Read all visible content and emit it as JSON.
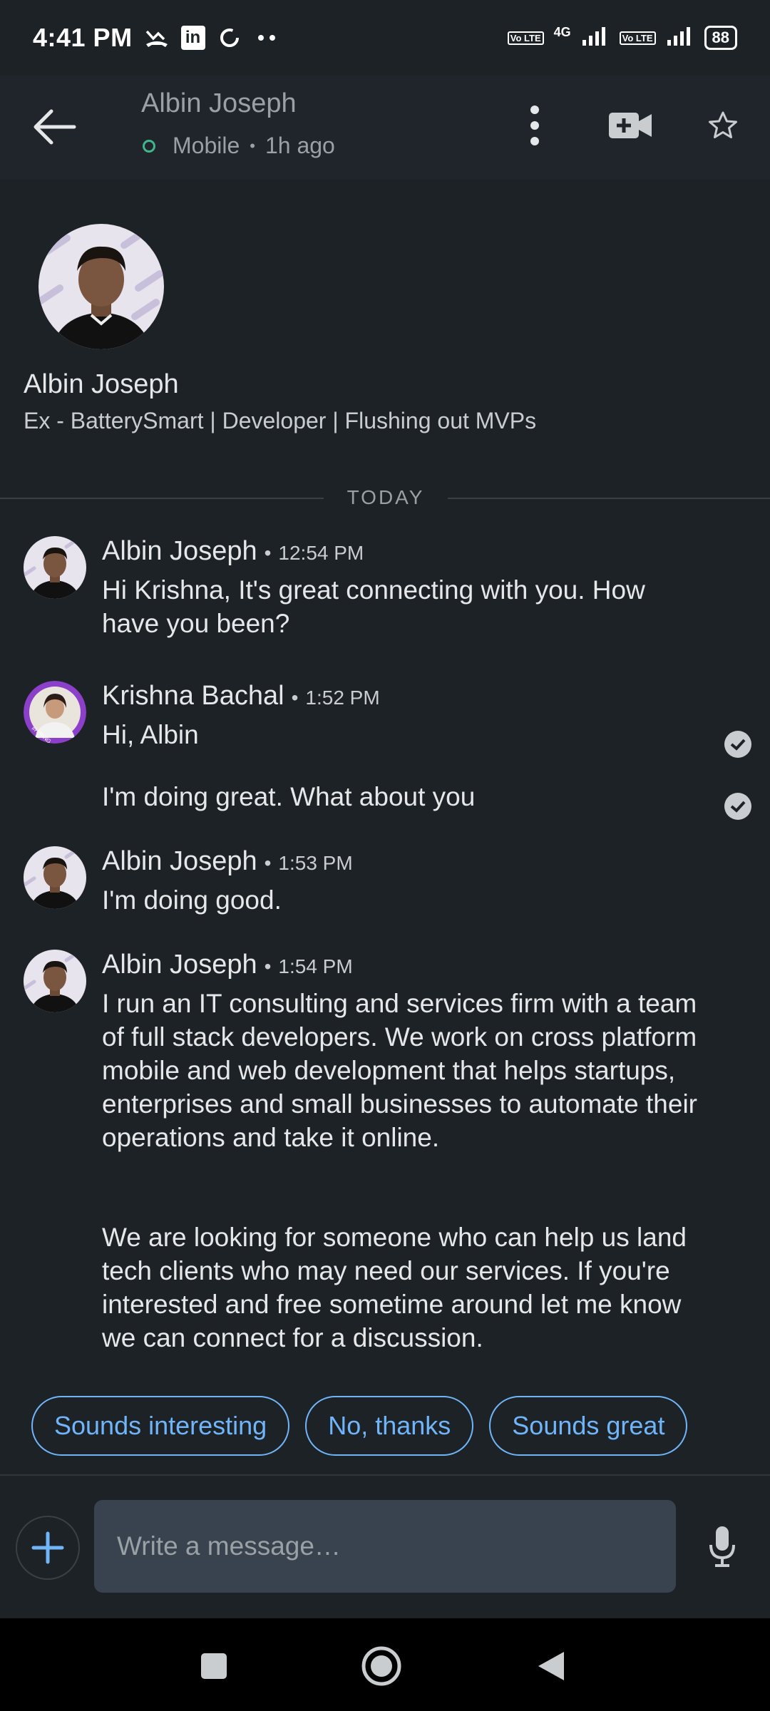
{
  "status_bar": {
    "time": "4:41 PM",
    "network_label": "4G",
    "volte_label": "Vo LTE",
    "battery": "88"
  },
  "header": {
    "name": "Albin Joseph",
    "device": "Mobile",
    "last_seen": "1h ago"
  },
  "profile": {
    "name": "Albin Joseph",
    "headline": "Ex - BatterySmart | Developer | Flushing out MVPs"
  },
  "divider_label": "TODAY",
  "messages": [
    {
      "sender": "Albin Joseph",
      "time": "12:54 PM",
      "text": "Hi Krishna, It's great connecting with you. How have you been?"
    },
    {
      "sender": "Krishna Bachal",
      "time": "1:52 PM",
      "lines": [
        "Hi, Albin",
        "I'm doing great. What about you"
      ]
    },
    {
      "sender": "Albin Joseph",
      "time": "1:53 PM",
      "text": "I'm doing good."
    },
    {
      "sender": "Albin Joseph",
      "time": "1:54 PM",
      "text": "I run an IT consulting and services firm with a team of full stack developers. We work on cross platform mobile and web development that helps startups, enterprises and small businesses to automate their operations and take it online.",
      "text2": "We are looking for someone who can help us land tech clients who may need our services. If you're interested and free sometime around let me know we can connect for a discussion."
    }
  ],
  "quick_replies": [
    "Sounds interesting",
    "No, thanks",
    "Sounds great"
  ],
  "composer": {
    "placeholder": "Write a message…"
  },
  "icons": {
    "back": "arrow-left-icon",
    "more": "more-vertical-icon",
    "video": "video-call-icon",
    "star": "star-icon",
    "plus": "plus-icon",
    "mic": "microphone-icon",
    "read": "check-circle-icon"
  },
  "colors": {
    "background": "#1d2226",
    "accent": "#70b5f9",
    "online": "#3fb68b",
    "input_bg": "#38434f"
  }
}
